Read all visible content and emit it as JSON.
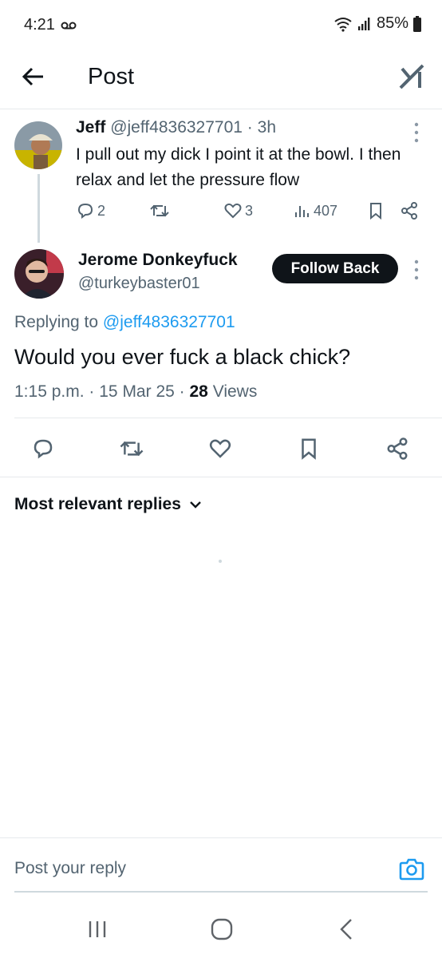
{
  "status_bar": {
    "time": "4:21",
    "battery": "85%"
  },
  "header": {
    "title": "Post"
  },
  "parent_tweet": {
    "name": "Jeff",
    "handle": "@jeff4836327701",
    "separator": "·",
    "time": "3h",
    "text": "I pull out my dick I point it at the bowl. I then relax and let the pressure flow",
    "replies": "2",
    "likes": "3",
    "views": "407"
  },
  "main_tweet": {
    "name": "Jerome Donkeyfuck",
    "handle": "@turkeybaster01",
    "follow_label": "Follow Back",
    "replying_prefix": "Replying to",
    "replying_handle": "@jeff4836327701",
    "text": "Would you ever fuck a black chick?",
    "time": "1:15 p.m.",
    "separator": "·",
    "date": "15 Mar 25",
    "views_count": "28",
    "views_label": "Views"
  },
  "replies_section": {
    "sort_label": "Most relevant replies"
  },
  "reply_bar": {
    "placeholder": "Post your reply"
  },
  "colors": {
    "accent": "#1d9bf0",
    "text": "#0f1419",
    "muted": "#536471"
  }
}
